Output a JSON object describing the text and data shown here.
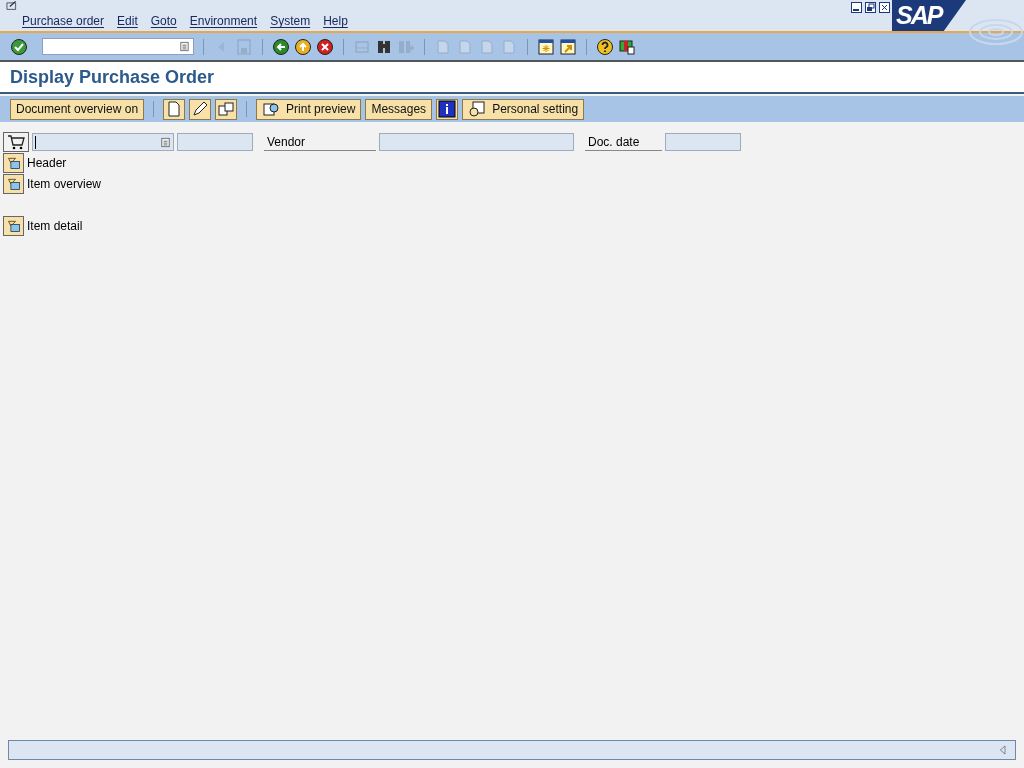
{
  "menu_bar": {
    "items": [
      "Purchase order",
      "Edit",
      "Goto",
      "Environment",
      "System",
      "Help"
    ],
    "logo": "SAP"
  },
  "standard_toolbar": {
    "groups": [
      [
        {
          "kind": "enter",
          "disabled": false
        }
      ],
      [
        {
          "kind": "command-field",
          "disabled": false
        }
      ],
      [
        {
          "kind": "back-triangle",
          "disabled": true
        },
        {
          "kind": "save",
          "disabled": true
        }
      ],
      [
        {
          "kind": "back",
          "disabled": false
        },
        {
          "kind": "exit",
          "disabled": false
        },
        {
          "kind": "cancel",
          "disabled": false
        }
      ],
      [
        {
          "kind": "print",
          "disabled": true
        },
        {
          "kind": "find",
          "disabled": false
        },
        {
          "kind": "find-next",
          "disabled": true
        }
      ],
      [
        {
          "kind": "page",
          "disabled": true
        },
        {
          "kind": "page",
          "disabled": true
        },
        {
          "kind": "page",
          "disabled": true
        },
        {
          "kind": "page",
          "disabled": true
        }
      ],
      [
        {
          "kind": "new-session",
          "disabled": false
        },
        {
          "kind": "shortcut",
          "disabled": false
        }
      ],
      [
        {
          "kind": "help",
          "disabled": false
        },
        {
          "kind": "layout",
          "disabled": false
        }
      ]
    ]
  },
  "title": "Display Purchase Order",
  "application_toolbar": [
    {
      "kind": "text",
      "label": "Document overview on"
    },
    {
      "kind": "separator"
    },
    {
      "kind": "icon"
    },
    {
      "kind": "icon"
    },
    {
      "kind": "icon"
    },
    {
      "kind": "separator"
    },
    {
      "kind": "icon-text",
      "label": "Print preview"
    },
    {
      "kind": "text",
      "label": "Messages"
    },
    {
      "kind": "icon"
    },
    {
      "kind": "icon-text",
      "label": "Personal setting"
    }
  ],
  "header_row": {
    "vendor_label": "Vendor",
    "doc_date_label": "Doc. date"
  },
  "section_groups": [
    [
      {
        "label": "Header"
      },
      {
        "label": "Item overview"
      }
    ],
    [
      {
        "label": "Item detail"
      }
    ]
  ]
}
